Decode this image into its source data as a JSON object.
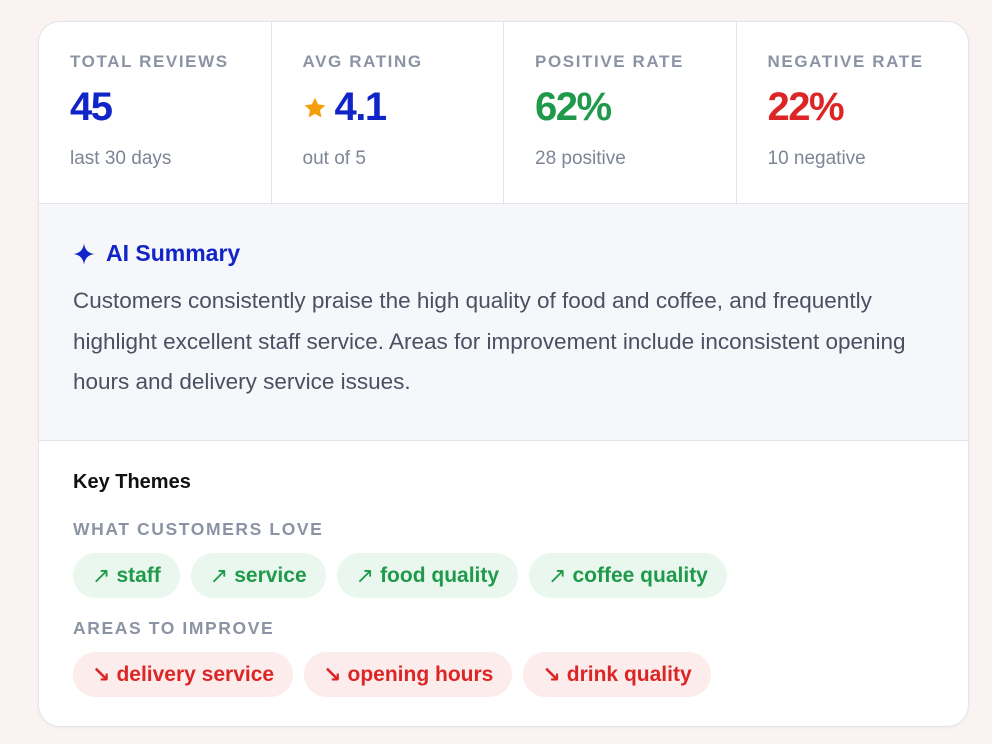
{
  "stats": [
    {
      "label": "TOTAL REVIEWS",
      "value": "45",
      "sub": "last 30 days",
      "color": "#1024c8",
      "icon": null
    },
    {
      "label": "AVG RATING",
      "value": "4.1",
      "sub": "out of 5",
      "color": "#1024c8",
      "icon": "star-icon"
    },
    {
      "label": "POSITIVE RATE",
      "value": "62%",
      "sub": "28 positive",
      "color": "#1f9a4a",
      "icon": null
    },
    {
      "label": "NEGATIVE RATE",
      "value": "22%",
      "sub": "10 negative",
      "color": "#dc2626",
      "icon": null
    }
  ],
  "summary": {
    "icon": "sparkle-icon",
    "title": "AI Summary",
    "text": "Customers consistently praise the high quality of food and coffee, and frequently highlight excellent staff service. Areas for improvement include inconsistent opening hours and delivery service issues."
  },
  "themes": {
    "title": "Key Themes",
    "love": {
      "label": "WHAT CUSTOMERS LOVE",
      "arrow": "↗",
      "items": [
        "staff",
        "service",
        "food quality",
        "coffee quality"
      ]
    },
    "improve": {
      "label": "AREAS TO IMPROVE",
      "arrow": "↘",
      "items": [
        "delivery service",
        "opening hours",
        "drink quality"
      ]
    }
  },
  "colors": {
    "accent_blue": "#1024c8",
    "positive_green": "#1f9a4a",
    "negative_red": "#dc2626",
    "star_orange": "#f59e0b"
  }
}
